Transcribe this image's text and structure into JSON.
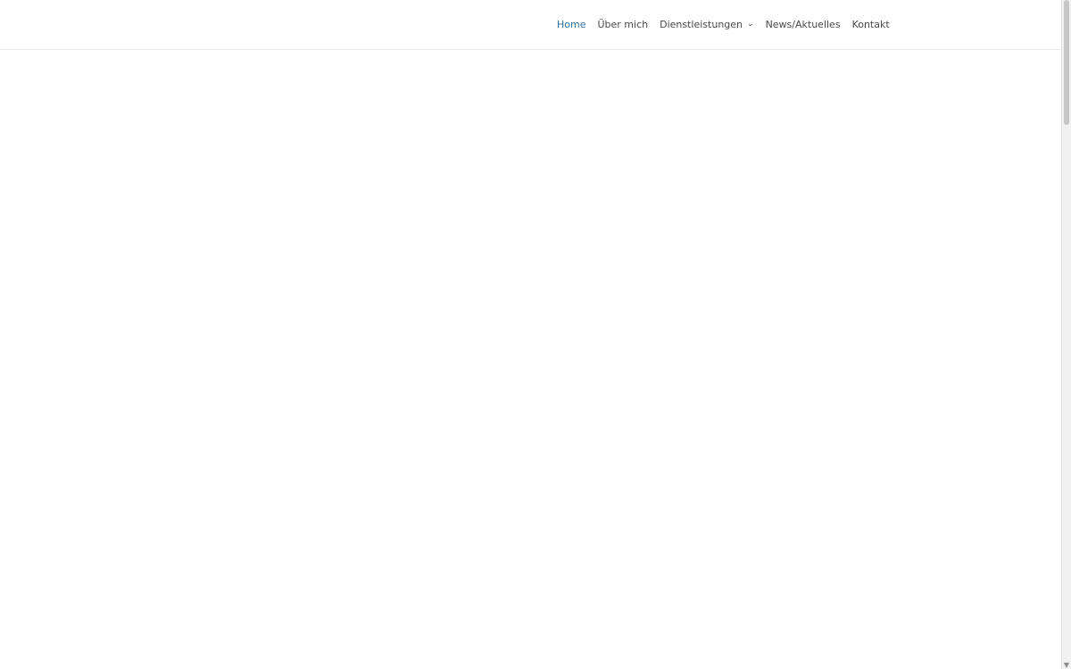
{
  "nav": {
    "items": [
      {
        "label": "Home",
        "active": true,
        "icon": null
      },
      {
        "label": "Über mich",
        "active": false,
        "icon": null
      },
      {
        "label": "Dienstleistungen",
        "active": false,
        "icon": "chevron-down-icon"
      },
      {
        "label": "News/Aktuelles",
        "active": false,
        "icon": null
      },
      {
        "label": "Kontakt",
        "active": false,
        "icon": null
      }
    ],
    "active_color": "#2b6fa1",
    "text_color": "#4a4a4a"
  },
  "page": {
    "background": "#ffffff"
  },
  "scrollbar": {
    "thumb_icon": "scrollbar-thumb",
    "arrow_icon": "scroll-down-arrow-icon"
  }
}
